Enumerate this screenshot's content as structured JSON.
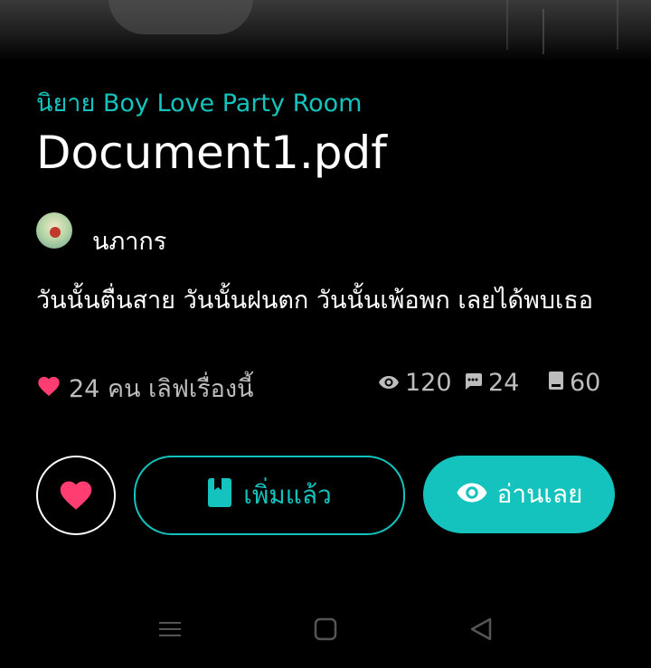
{
  "story": {
    "category": "นิยาย Boy Love Party Room",
    "title": "Document1.pdf",
    "author": "นภากร",
    "description": "วันนั้นตื่นสาย วันนั้นฝนตก วันนั้นเพ้อพก เลยได้พบเธอ"
  },
  "stats": {
    "likes_text": "24 คน เลิฟเรื่องนี้",
    "views": "120",
    "comments": "24",
    "chapters": "60"
  },
  "actions": {
    "added_label": "เพิ่มแล้ว",
    "read_label": "อ่านเลย"
  },
  "icons": [
    "heart-icon",
    "eye-icon",
    "comment-icon",
    "book-icon",
    "bookmark-icon",
    "menu-icon",
    "home-icon",
    "back-icon"
  ],
  "colors": {
    "accent": "#14c3bd",
    "heart": "#ff3d71",
    "background": "#000000"
  }
}
